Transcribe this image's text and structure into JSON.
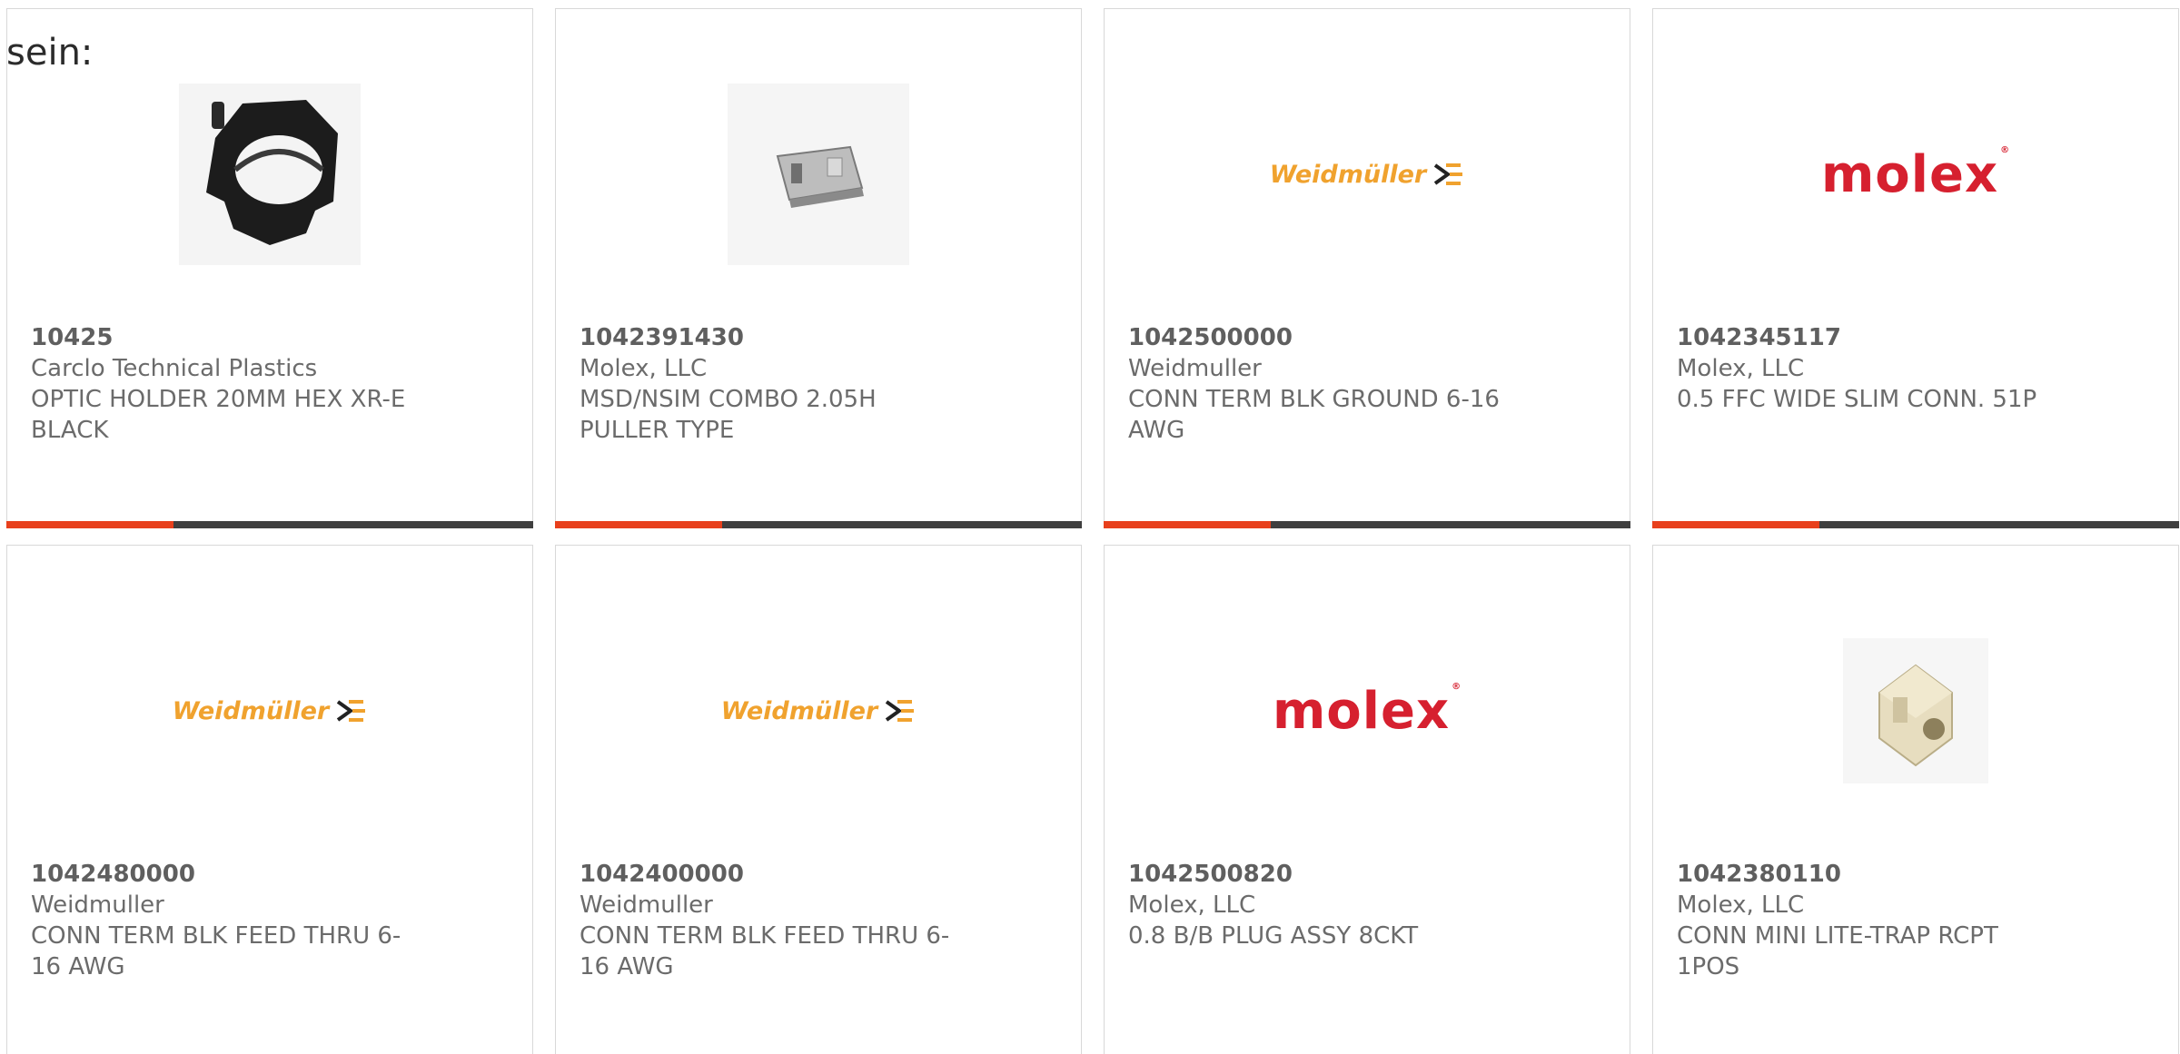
{
  "intro_text": "sein:",
  "colors": {
    "accent": "#e8401c",
    "bar": "#3f3f3f",
    "molex": "#d6202f",
    "weidmuller": "#f0a22e"
  },
  "products": [
    {
      "part_number": "10425",
      "manufacturer": "Carclo Technical Plastics",
      "description_line1": "OPTIC HOLDER 20MM HEX XR-E",
      "description_line2": "BLACK",
      "image": "optic-holder-photo"
    },
    {
      "part_number": "1042391430",
      "manufacturer": "Molex, LLC",
      "description_line1": "MSD/NSIM COMBO 2.05H",
      "description_line2": "PULLER TYPE",
      "image": "card-socket-photo"
    },
    {
      "part_number": "1042500000",
      "manufacturer": "Weidmuller",
      "description_line1": "CONN TERM BLK GROUND 6-16",
      "description_line2": "AWG",
      "image": "weidmuller-logo",
      "logo_text": "Weidmüller"
    },
    {
      "part_number": "1042345117",
      "manufacturer": "Molex, LLC",
      "description_line1": "0.5 FFC WIDE SLIM CONN. 51P",
      "description_line2": "",
      "image": "molex-logo",
      "logo_text": "molex"
    },
    {
      "part_number": "1042480000",
      "manufacturer": "Weidmuller",
      "description_line1": "CONN TERM BLK FEED THRU 6-",
      "description_line2": "16 AWG",
      "image": "weidmuller-logo",
      "logo_text": "Weidmüller"
    },
    {
      "part_number": "1042400000",
      "manufacturer": "Weidmuller",
      "description_line1": "CONN TERM BLK FEED THRU 6-",
      "description_line2": "16 AWG",
      "image": "weidmuller-logo",
      "logo_text": "Weidmüller"
    },
    {
      "part_number": "1042500820",
      "manufacturer": "Molex, LLC",
      "description_line1": "0.8 B/B PLUG ASSY 8CKT",
      "description_line2": "",
      "image": "molex-logo",
      "logo_text": "molex"
    },
    {
      "part_number": "1042380110",
      "manufacturer": "Molex, LLC",
      "description_line1": "CONN MINI LITE-TRAP RCPT",
      "description_line2": "1POS",
      "image": "lite-trap-photo"
    }
  ]
}
